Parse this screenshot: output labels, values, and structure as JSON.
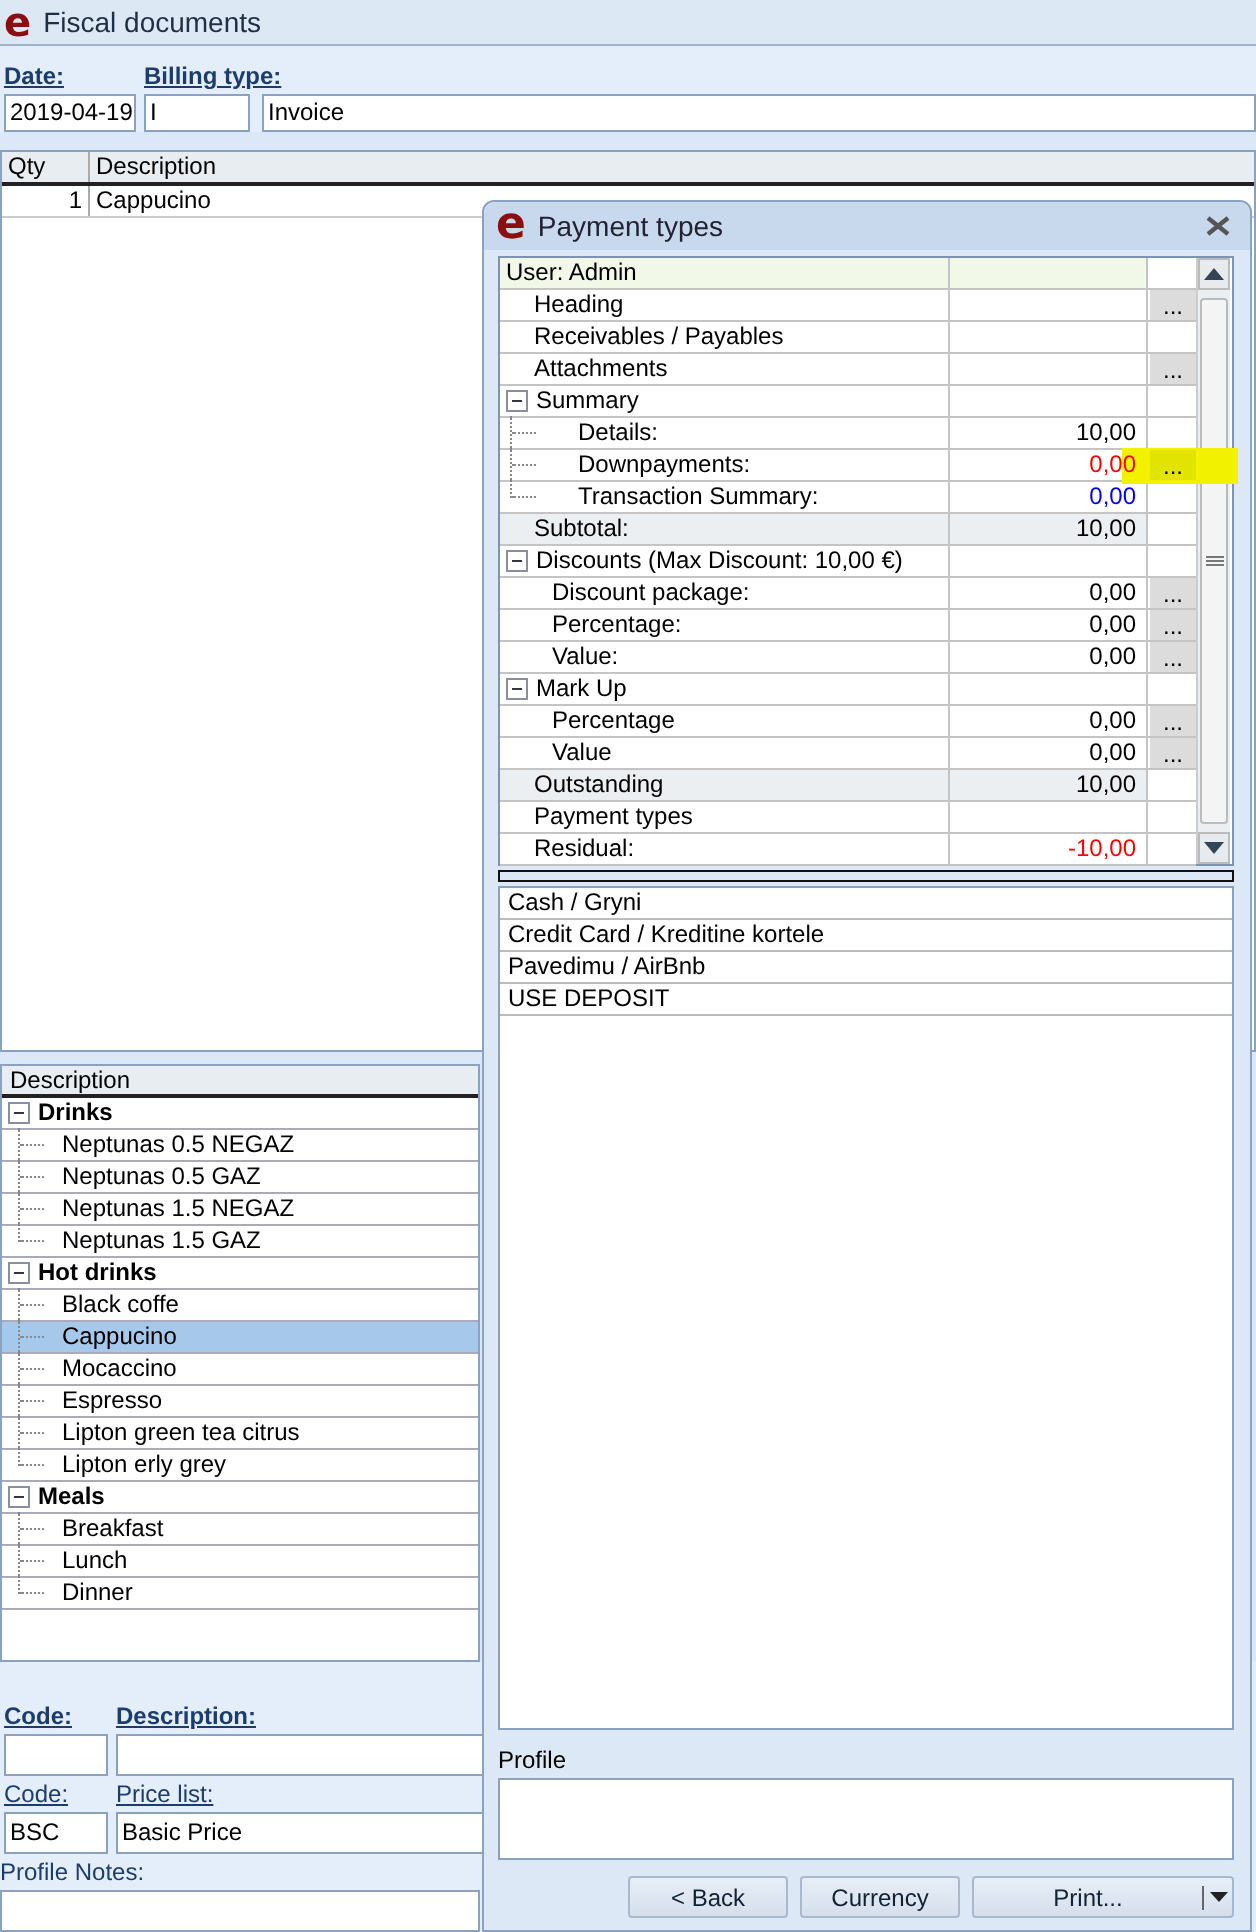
{
  "main_window": {
    "logo": "e",
    "title": "Fiscal documents",
    "header_fields": [
      {
        "label": "Date:",
        "bold": true,
        "values": [
          "2019-04-19"
        ]
      },
      {
        "label": "Billing type:",
        "bold": true,
        "values": [
          "I",
          "Invoice"
        ]
      }
    ],
    "order_table": {
      "columns": [
        "Qty",
        "Description"
      ],
      "rows": [
        [
          "1",
          "Cappucino"
        ]
      ]
    },
    "products": {
      "column": "Description",
      "groups": [
        {
          "label": "Drinks",
          "expanded": true,
          "children": [
            {
              "label": "Neptunas 0.5 NEGAZ",
              "selected": false
            },
            {
              "label": "Neptunas 0.5 GAZ",
              "selected": false
            },
            {
              "label": "Neptunas 1.5 NEGAZ",
              "selected": false
            },
            {
              "label": "Neptunas 1.5 GAZ",
              "selected": false
            }
          ]
        },
        {
          "label": "Hot drinks",
          "expanded": true,
          "children": [
            {
              "label": "Black coffe",
              "selected": false
            },
            {
              "label": "Cappucino",
              "selected": true
            },
            {
              "label": "Mocaccino",
              "selected": false
            },
            {
              "label": "Espresso",
              "selected": false
            },
            {
              "label": "Lipton green tea citrus",
              "selected": false
            },
            {
              "label": "Lipton erly grey",
              "selected": false
            }
          ]
        },
        {
          "label": "Meals",
          "expanded": true,
          "children": [
            {
              "label": "Breakfast",
              "selected": false
            },
            {
              "label": "Lunch",
              "selected": false
            },
            {
              "label": "Dinner",
              "selected": false
            }
          ]
        }
      ]
    },
    "footer_fields": [
      [
        {
          "label": "Code:",
          "bold": true
        },
        {
          "label": "Description:",
          "bold": true
        }
      ],
      [
        {
          "label": "Code:",
          "bold": false,
          "values": [
            "BSC"
          ]
        },
        {
          "label": "Price list:",
          "bold": false,
          "values": [
            "Basic Price"
          ]
        }
      ]
    ],
    "profile_notes_label": "Profile Notes:"
  },
  "dialog": {
    "logo": "e",
    "title": "Payment types",
    "grid": [
      {
        "kind": "header",
        "label": "User: Admin"
      },
      {
        "kind": "item",
        "label": "Heading",
        "button": "..."
      },
      {
        "kind": "item",
        "label": "Receivables / Payables"
      },
      {
        "kind": "item",
        "label": "Attachments",
        "button": "..."
      },
      {
        "kind": "group",
        "label": "Summary",
        "expanded": true,
        "tree_lines": true,
        "children": [
          {
            "kind": "item",
            "label": "Details:",
            "value": "10,00"
          },
          {
            "kind": "item",
            "label": "Downpayments:",
            "value": "0,00",
            "color": "#ff0000",
            "button": "...",
            "highlighted": true
          },
          {
            "kind": "item",
            "label": "Transaction Summary:",
            "value": "0,00",
            "color": "#0000ff"
          }
        ]
      },
      {
        "kind": "total",
        "label": "Subtotal:",
        "value": "10,00"
      },
      {
        "kind": "group",
        "label": "Discounts (Max Discount: 10,00 €)",
        "expanded": true,
        "tree_lines": false,
        "children": [
          {
            "kind": "item",
            "label": "Discount package:",
            "value": "0,00",
            "button": "..."
          },
          {
            "kind": "item",
            "label": "Percentage:",
            "value": "0,00",
            "button": "..."
          },
          {
            "kind": "item",
            "label": "Value:",
            "value": "0,00",
            "button": "..."
          }
        ]
      },
      {
        "kind": "group",
        "label": "Mark Up",
        "expanded": true,
        "tree_lines": false,
        "children": [
          {
            "kind": "item",
            "label": "Percentage",
            "value": "0,00",
            "button": "..."
          },
          {
            "kind": "item",
            "label": "Value",
            "value": "0,00",
            "button": "..."
          }
        ]
      },
      {
        "kind": "total",
        "label": "Outstanding",
        "value": "10,00"
      },
      {
        "kind": "item",
        "label": "Payment types"
      },
      {
        "kind": "item",
        "label": "Residual:",
        "value": "-10,00",
        "color": "#ff0000"
      }
    ],
    "payment_types": [
      "Cash / Gryni",
      "Credit Card / Kreditine kortele",
      "Pavedimu / AirBnb",
      "USE DEPOSIT"
    ],
    "profile_label": "Profile",
    "buttons": [
      {
        "label": "< Back",
        "kind": "plain"
      },
      {
        "label": "Currency",
        "kind": "plain"
      },
      {
        "label": "Print...",
        "kind": "split"
      }
    ]
  }
}
